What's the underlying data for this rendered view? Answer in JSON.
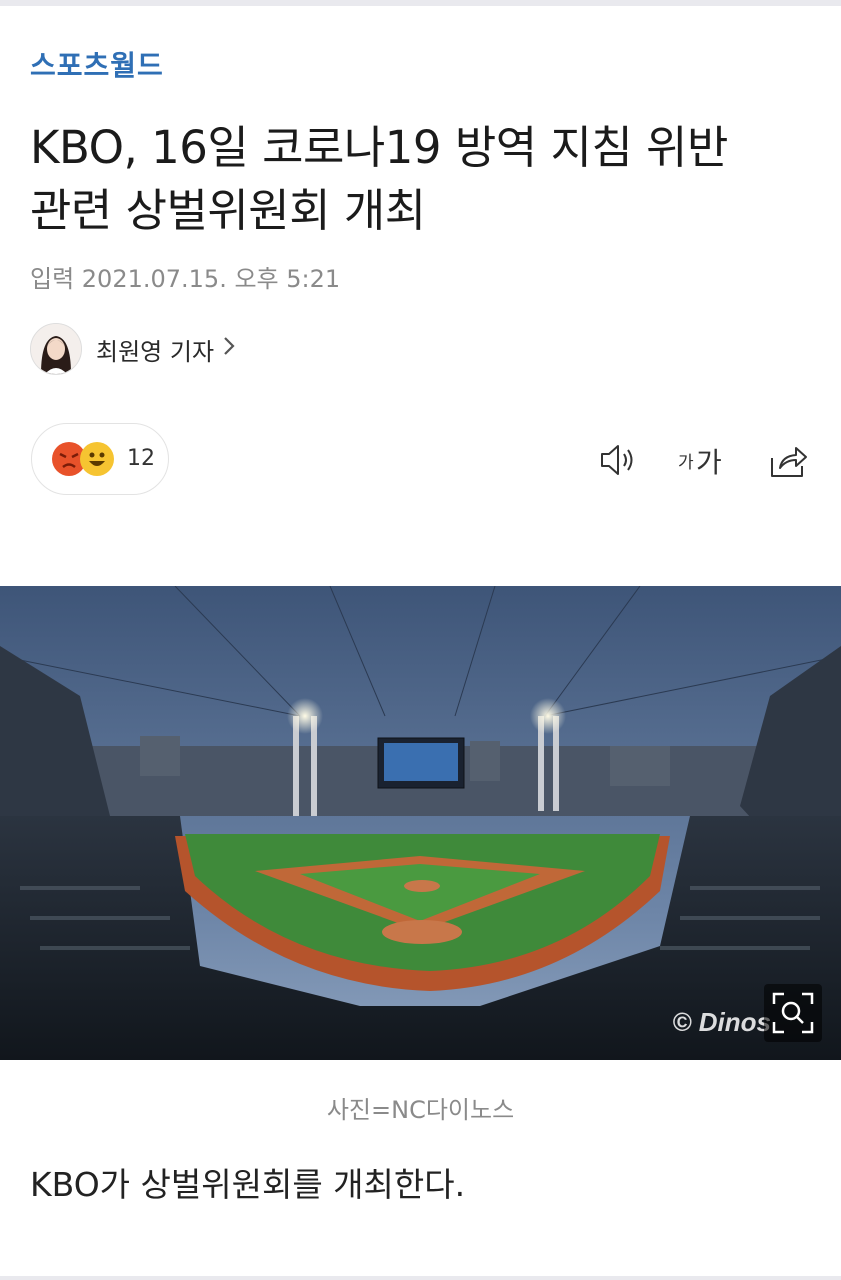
{
  "header": {
    "logo_text": "스포츠월드"
  },
  "article": {
    "title_line1": "KBO, 16일 코로나19 방역 지침 위반",
    "title_line2": "관련 상벌위원회 개최",
    "date": "입력 2021.07.15. 오후 5:21",
    "reporter": "최원영 기자",
    "reaction_count": "12",
    "font_size_button": "가가",
    "photo_watermark": "© Dinos",
    "photo_caption": "사진=NC다이노스",
    "body_first_line": "KBO가 상벌위원회를 개최한다."
  },
  "icons": {
    "reporter_chevron": "chevron-right-icon",
    "speaker": "speaker-icon",
    "share": "share-icon",
    "zoom": "zoom-icon",
    "reaction_angry": "angry-emoji-icon",
    "reaction_happy": "happy-emoji-icon"
  },
  "colors": {
    "logo": "#2f6fb5",
    "angry": "#e8522a",
    "happy": "#f6c431"
  }
}
